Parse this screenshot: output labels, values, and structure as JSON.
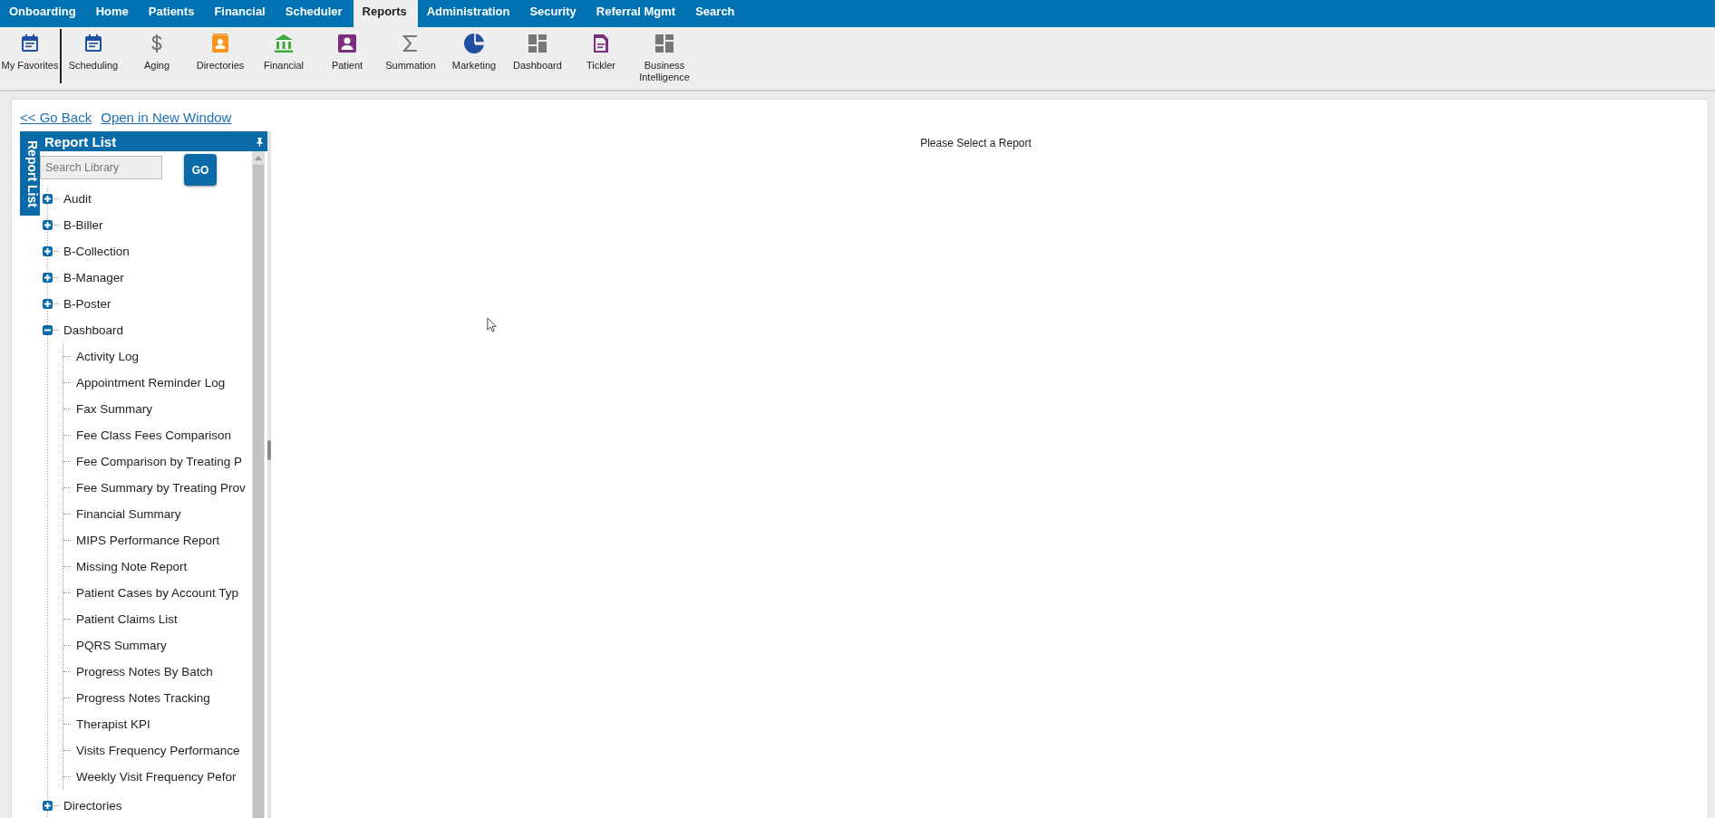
{
  "nav_tabs": [
    {
      "label": "Onboarding",
      "selected": false
    },
    {
      "label": "Home",
      "selected": false
    },
    {
      "label": "Patients",
      "selected": false
    },
    {
      "label": "Financial",
      "selected": false
    },
    {
      "label": "Scheduler",
      "selected": false
    },
    {
      "label": "Reports",
      "selected": true
    },
    {
      "label": "Administration",
      "selected": false
    },
    {
      "label": "Security",
      "selected": false
    },
    {
      "label": "Referral Mgmt",
      "selected": false
    },
    {
      "label": "Search",
      "selected": false
    }
  ],
  "favorites": {
    "label": "My Favorites"
  },
  "toolbar": [
    {
      "label": "Scheduling"
    },
    {
      "label": "Aging"
    },
    {
      "label": "Directories"
    },
    {
      "label": "Financial"
    },
    {
      "label": "Patient"
    },
    {
      "label": "Summation"
    },
    {
      "label": "Marketing"
    },
    {
      "label": "Dashboard"
    },
    {
      "label": "Tickler"
    },
    {
      "label": "Business Intelligence"
    }
  ],
  "links": [
    "<< Go Back",
    "Open in New Window"
  ],
  "report_list": {
    "title": "Report List",
    "side_tab": "Report List",
    "search": {
      "placeholder": "Search Library"
    },
    "go_button": "GO",
    "tree": [
      {
        "label": "Audit",
        "expanded": false
      },
      {
        "label": "B-Biller",
        "expanded": false
      },
      {
        "label": "B-Collection",
        "expanded": false
      },
      {
        "label": "B-Manager",
        "expanded": false
      },
      {
        "label": "B-Poster",
        "expanded": false
      },
      {
        "label": "Dashboard",
        "expanded": true,
        "children": [
          {
            "label": "Activity Log"
          },
          {
            "label": "Appointment Reminder Log"
          },
          {
            "label": "Fax Summary"
          },
          {
            "label": "Fee Class Fees Comparison"
          },
          {
            "label": "Fee Comparison by Treating P"
          },
          {
            "label": "Fee Summary by Treating Prov"
          },
          {
            "label": "Financial Summary"
          },
          {
            "label": "MIPS Performance Report"
          },
          {
            "label": "Missing Note Report"
          },
          {
            "label": "Patient Cases by Account Typ"
          },
          {
            "label": "Patient Claims List"
          },
          {
            "label": "PQRS Summary"
          },
          {
            "label": "Progress Notes By Batch"
          },
          {
            "label": "Progress Notes Tracking"
          },
          {
            "label": "Therapist KPI"
          },
          {
            "label": "Visits Frequency Performance"
          },
          {
            "label": "Weekly Visit Frequency Pefor"
          }
        ]
      },
      {
        "label": "Directories",
        "expanded": false
      }
    ]
  },
  "main": {
    "message": "Please Select a Report"
  }
}
